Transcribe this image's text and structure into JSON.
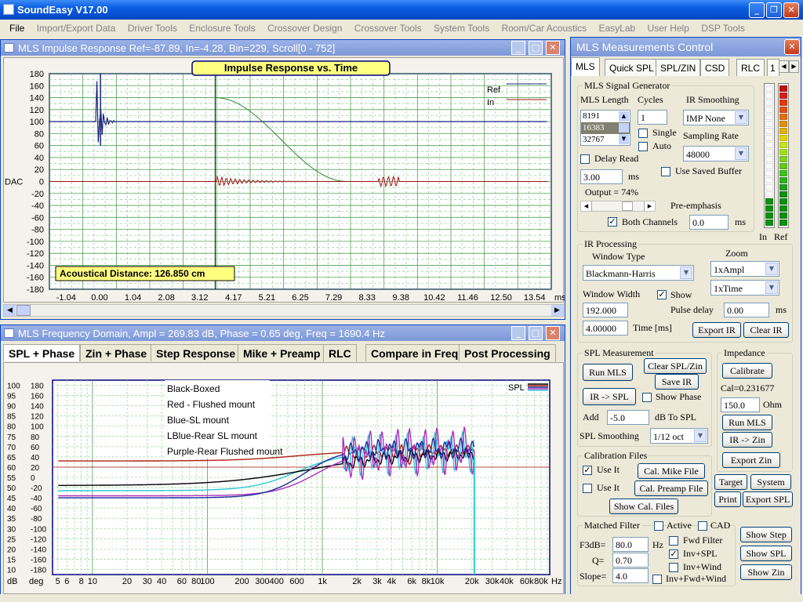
{
  "app": {
    "title": "SoundEasy V17.00"
  },
  "menu": [
    "File",
    "Import/Export Data",
    "Driver Tools",
    "Enclosure Tools",
    "Crossover Design",
    "Crossover Tools",
    "System Tools",
    "Room/Car Acoustics",
    "EasyLab",
    "User Help",
    "DSP Tools"
  ],
  "impulse": {
    "window_title": "MLS Impulse Response  Ref=-87.89, In=-4.28, Bin=229, Scroll[0 - 752]",
    "plot_title": "Impulse Response vs. Time",
    "ylabel": "DAC",
    "xunit": "ms",
    "yticks": [
      "180",
      "160",
      "140",
      "120",
      "100",
      "80",
      "60",
      "40",
      "20",
      "0",
      "-20",
      "-40",
      "-60",
      "-80",
      "-100",
      "-120",
      "-140",
      "-160",
      "-180"
    ],
    "xticks": [
      "-1.04",
      "0.00",
      "1.04",
      "2.08",
      "3.12",
      "4.17",
      "5.21",
      "6.25",
      "7.29",
      "8.33",
      "9.38",
      "10.42",
      "11.46",
      "12.50",
      "13.54"
    ],
    "legend": [
      "Ref",
      "In"
    ],
    "distance": "Acoustical Distance: 126.850 cm",
    "colors": {
      "ref": "#1a237e",
      "in": "#a01010",
      "window": "#2e8b2e"
    }
  },
  "freq": {
    "window_title": "MLS Frequency Domain, Ampl = 269.83 dB, Phase = 0.65 deg, Freq = 1690.4 Hz",
    "tabs": [
      "SPL + Phase",
      "Zin + Phase",
      "Step Response",
      "Mike + Preamp",
      "RLC",
      "Compare in Freq",
      "Post Processing"
    ],
    "ylabel_db": "dB",
    "ylabel_deg": "deg",
    "db_ticks": [
      "100",
      "95",
      "90",
      "85",
      "80",
      "75",
      "70",
      "65",
      "60",
      "55",
      "50",
      "45",
      "40",
      "35",
      "30",
      "25",
      "20",
      "15",
      "10"
    ],
    "deg_ticks": [
      "180",
      "160",
      "140",
      "120",
      "100",
      "80",
      "60",
      "40",
      "20",
      "0",
      "-20",
      "-40",
      "-60",
      "-80",
      "-100",
      "-120",
      "-140",
      "-160",
      "-180"
    ],
    "xticks": [
      "5",
      "6",
      "8",
      "10",
      "20",
      "30",
      "40",
      "60",
      "80",
      "100",
      "200",
      "300",
      "400",
      "600",
      "1k",
      "2k",
      "3k",
      "4k",
      "6k",
      "8k",
      "10k",
      "20k",
      "30k",
      "40k",
      "60k",
      "80k",
      "Hz"
    ],
    "notes": [
      "Black-Boxed",
      "Red - Flushed mount",
      "Blue-SL mount",
      "LBlue-Rear SL mount",
      "Purple-Rear Flushed mount"
    ],
    "legend": "SPL",
    "colors": {
      "black": "#000000",
      "red": "#b02010",
      "blue": "#1a2a9a",
      "lblue": "#30c8d8",
      "purple": "#b030c0"
    }
  },
  "control": {
    "title": "MLS Measurements Control",
    "tabs": [
      "MLS",
      "Quick SPL",
      "SPL/ZIN",
      "CSD",
      "RLC",
      "1"
    ],
    "gen": {
      "label": "MLS Signal Generator",
      "mls_length": "MLS Length",
      "cycles": "Cycles",
      "ir_smoothing": "IR Smoothing",
      "mls_options": [
        "8191",
        "16383",
        "32767"
      ],
      "cycles_value": "1",
      "smoothing_value": "IMP None",
      "single": "Single",
      "auto": "Auto",
      "sampling_rate": "Sampling Rate",
      "rate_value": "48000",
      "delay_read": "Delay Read",
      "delay_value": "3.00",
      "ms": "ms",
      "use_saved": "Use Saved Buffer",
      "output": "Output = 74%",
      "pre_emphasis": "Pre-emphasis",
      "both_channels": "Both Channels",
      "pre_value": "0.0",
      "ms2": "ms"
    },
    "meters": {
      "in": "In",
      "ref": "Ref"
    },
    "ir": {
      "label": "IR Processing",
      "window_type": "Window Type",
      "window_value": "Blackmann-Harris",
      "zoom": "Zoom",
      "zoom_ampl": "1xAmpl",
      "zoom_time": "1xTime",
      "window_width": "Window Width",
      "show": "Show",
      "width_value": "192.000",
      "pulse_delay": "Pulse delay",
      "pulse_value": "0.00",
      "ms": "ms",
      "time_value": "4.00000",
      "time_label": "Time [ms]",
      "export_ir": "Export IR",
      "clear_ir": "Clear IR"
    },
    "spl": {
      "label": "SPL Measurement",
      "run_mls": "Run MLS",
      "clear_spl": "Clear SPL/Zin",
      "save_ir": "Save IR",
      "ir_spl": "IR -> SPL",
      "show_phase": "Show Phase",
      "add": "Add",
      "add_value": "-5.0",
      "db_to_spl": "dB  To SPL",
      "smoothing": "SPL Smoothing",
      "smoothing_value": "1/12 oct"
    },
    "imp": {
      "label": "Impedance",
      "calibrate": "Calibrate",
      "cal_value": "Cal=0.231677",
      "ohm_value": "150.0",
      "ohm": "Ohm",
      "run_mls": "Run MLS",
      "ir_zin": "IR -> Zin",
      "export_zin": "Export Zin"
    },
    "cal": {
      "label": "Calibration Files",
      "use_it1": "Use It",
      "mike_file": "Cal. Mike File",
      "use_it2": "Use It",
      "preamp_file": "Cal. Preamp File",
      "show_files": "Show Cal. Files"
    },
    "side_buttons": {
      "target": "Target",
      "system": "System",
      "print": "Print",
      "export_spl": "Export SPL"
    },
    "mf": {
      "label": "Matched Filter",
      "active": "Active",
      "cad": "CAD",
      "f3db": "F3dB=",
      "f3db_value": "80.0",
      "hz": "Hz",
      "q": "Q=",
      "q_value": "0.70",
      "slope": "Slope=",
      "slope_value": "4.0",
      "fwd_filter": "Fwd Filter",
      "inv_spl": "Inv+SPL",
      "inv_wind": "Inv+Wind",
      "inv_fwd_wind": "Inv+Fwd+Wind"
    },
    "show_buttons": {
      "step": "Show Step",
      "spl": "Show SPL",
      "zin": "Show Zin"
    }
  }
}
